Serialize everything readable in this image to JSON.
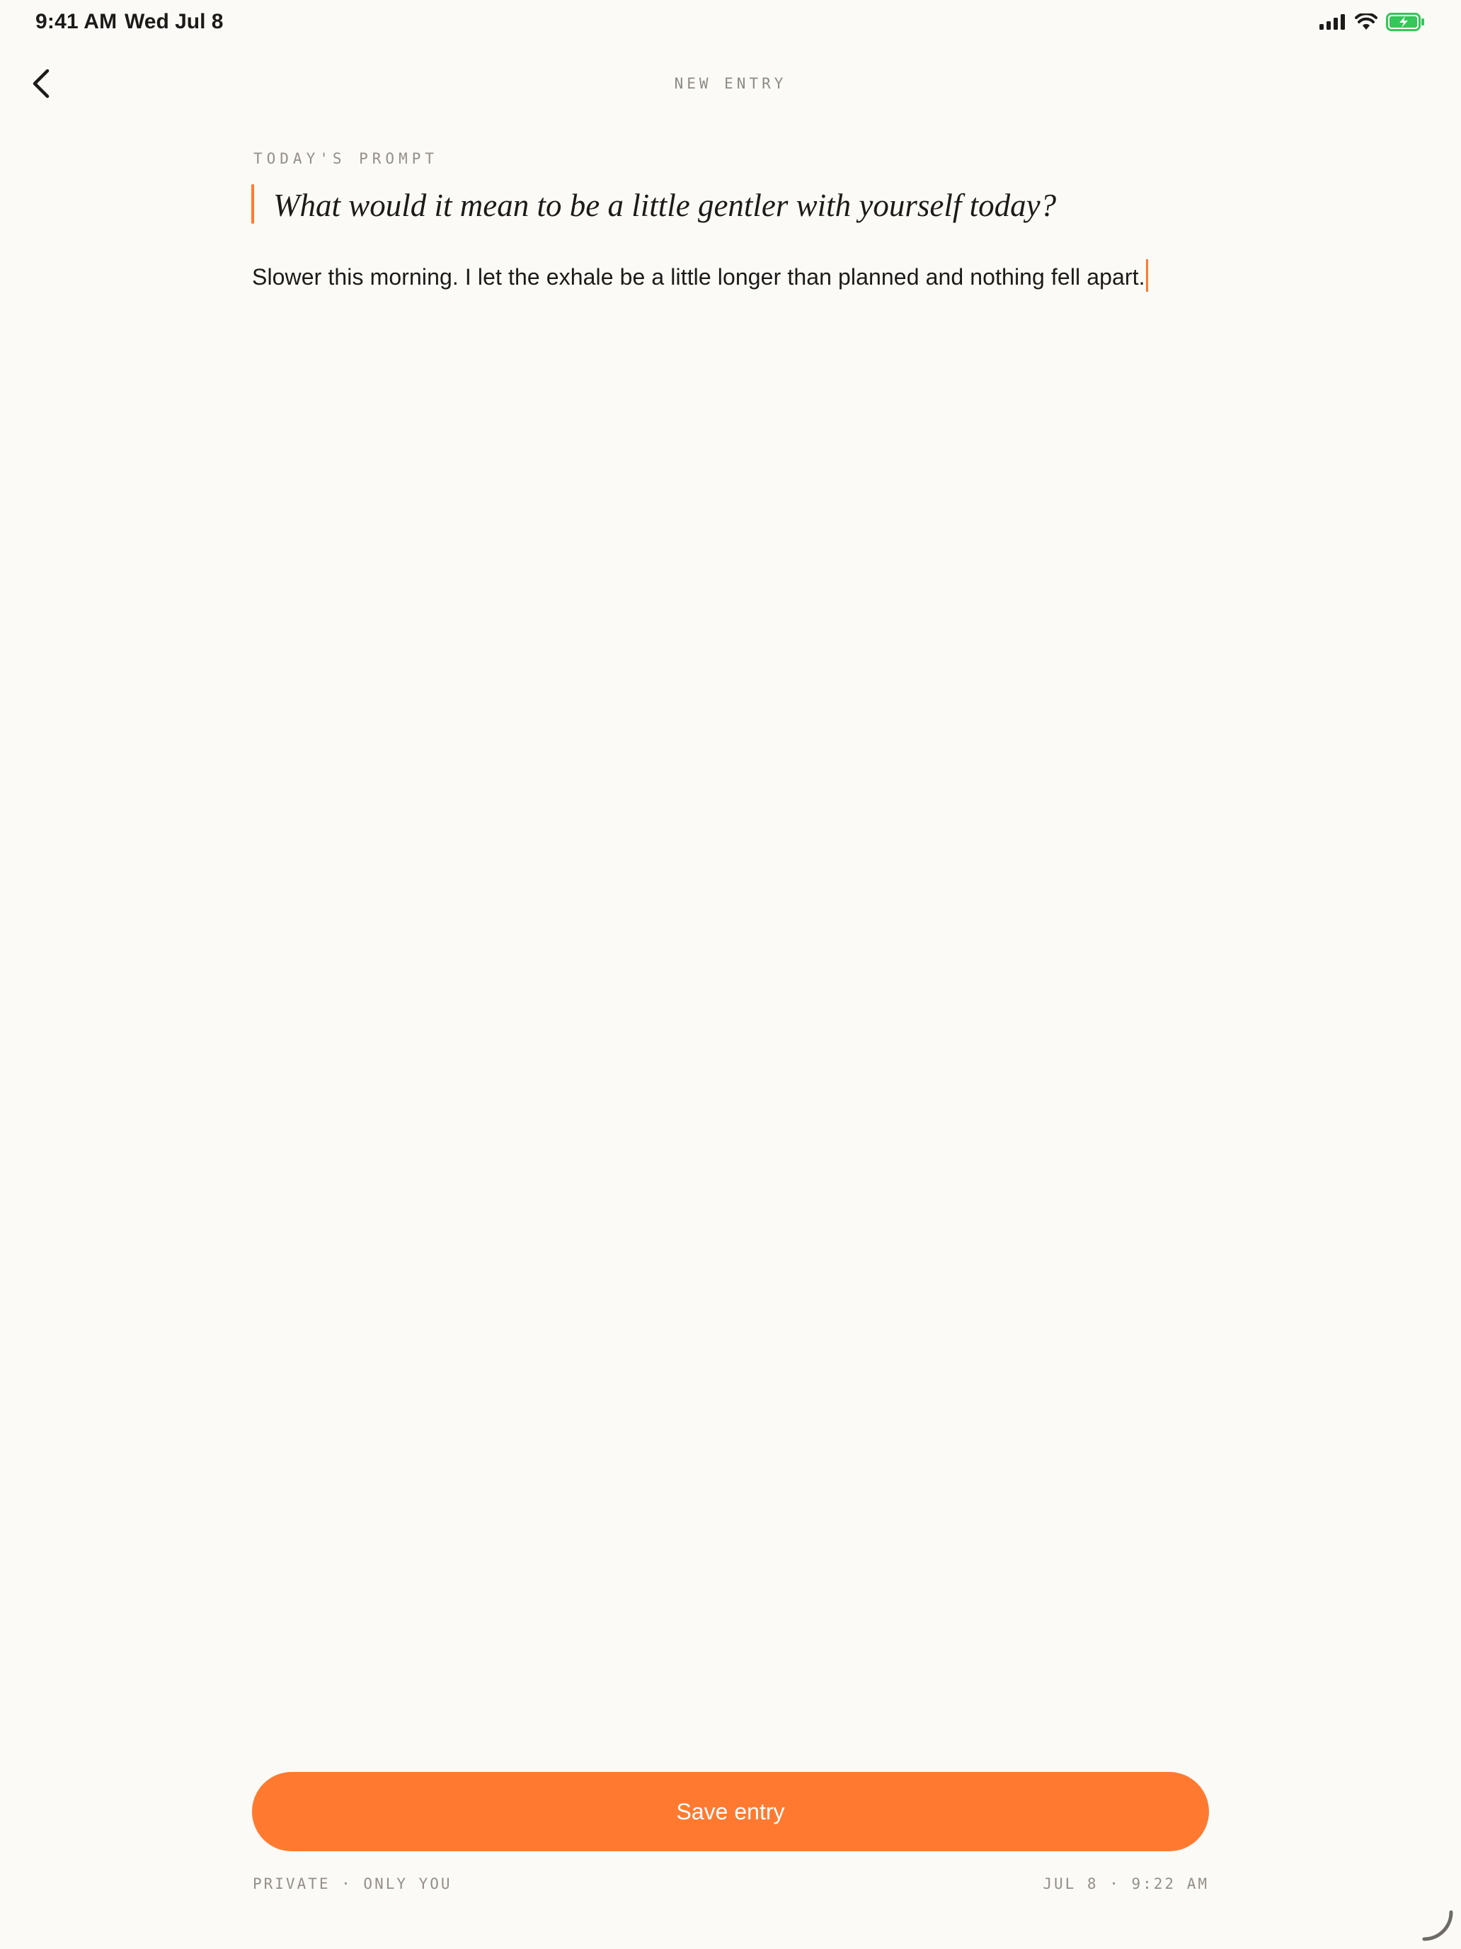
{
  "status_bar": {
    "time": "9:41 AM",
    "date": "Wed Jul 8",
    "icons": [
      "cellular-signal-icon",
      "wifi-icon",
      "battery-charging-icon"
    ],
    "battery_color": "#34c759"
  },
  "nav": {
    "back_icon": "chevron-left-icon",
    "title": "NEW ENTRY"
  },
  "prompt": {
    "label": "TODAY'S PROMPT",
    "text": "What would it mean to be a little gentler with yourself today?"
  },
  "entry": {
    "body": "Slower this morning. I let the exhale be a little longer than planned and nothing fell apart."
  },
  "actions": {
    "save_label": "Save entry"
  },
  "footer": {
    "privacy": "PRIVATE · ONLY YOU",
    "timestamp": "JUL 8 · 9:22 AM"
  },
  "colors": {
    "accent": "#ff7a30",
    "background": "#fbfaf6",
    "text": "#1d1b19",
    "muted": "#948f89"
  }
}
